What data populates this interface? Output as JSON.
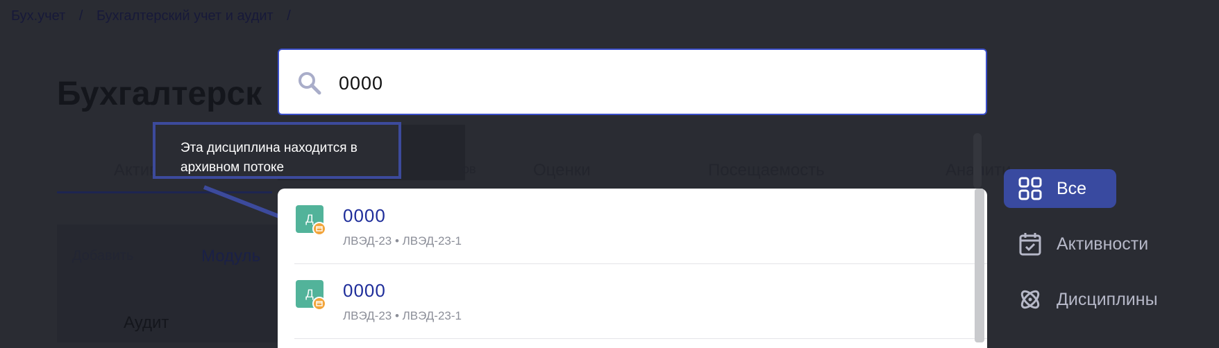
{
  "breadcrumb": {
    "items": [
      "Бух.учет",
      "Бухгалтерский учет и аудит"
    ],
    "separator": "/"
  },
  "page_title": "Бухгалтерск",
  "background_tabs": [
    "Активн",
    "ов",
    "Оценки",
    "Посещаемость",
    "Аналити"
  ],
  "background_panel": {
    "add_label": "Добавить",
    "module_label": "Модуль",
    "audit_label": "Аудит"
  },
  "search": {
    "value": "0000",
    "icon": "search-icon"
  },
  "tooltip": {
    "text": "Эта дисциплина находится в архивном потоке"
  },
  "results": [
    {
      "avatar": "Д",
      "title": "0000",
      "subtitle": "ЛВЭД-23 • ЛВЭД-23-1",
      "badge": "archive-icon"
    },
    {
      "avatar": "Д",
      "title": "0000",
      "subtitle": "ЛВЭД-23 • ЛВЭД-23-1",
      "badge": "archive-icon"
    }
  ],
  "filters": [
    {
      "label": "Все",
      "icon": "grid-icon",
      "active": true
    },
    {
      "label": "Активности",
      "icon": "calendar-check-icon",
      "active": false
    },
    {
      "label": "Дисциплины",
      "icon": "atom-icon",
      "active": false
    }
  ],
  "colors": {
    "accent": "#394aa0",
    "avatar": "#52b39a",
    "badge": "#f2a43a",
    "link": "#1e2d9a"
  }
}
